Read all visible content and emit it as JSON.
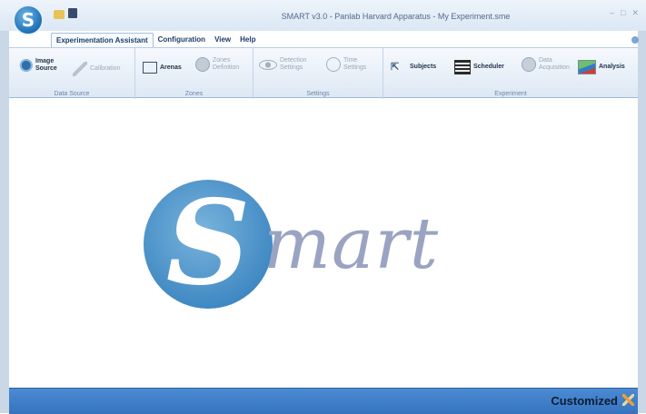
{
  "window": {
    "title": "SMART v3.0 - Panlab Harvard Apparatus - My Experiment.sme",
    "controls": [
      "minimize",
      "maximize",
      "close"
    ]
  },
  "quick_access": [
    "open-folder-icon",
    "save-icon"
  ],
  "tabs": [
    {
      "label": "Experimentation Assistant",
      "active": true
    },
    {
      "label": "Configuration",
      "active": false
    },
    {
      "label": "View",
      "active": false
    },
    {
      "label": "Help",
      "active": false
    }
  ],
  "ribbon": {
    "groups": [
      {
        "label": "Data Source",
        "buttons": [
          {
            "label_line1": "Image",
            "label_line2": "Source",
            "icon": "camera-icon",
            "enabled": true
          },
          {
            "label_line1": "Calibration",
            "label_line2": "",
            "icon": "ruler-icon",
            "enabled": false
          }
        ]
      },
      {
        "label": "Zones",
        "buttons": [
          {
            "label_line1": "Arenas",
            "label_line2": "",
            "icon": "arena-grid-icon",
            "enabled": true
          },
          {
            "label_line1": "Zones",
            "label_line2": "Definition",
            "icon": "zones-icon",
            "enabled": false
          }
        ]
      },
      {
        "label": "Settings",
        "buttons": [
          {
            "label_line1": "Detection",
            "label_line2": "Settings",
            "icon": "eye-icon",
            "enabled": false
          },
          {
            "label_line1": "Time",
            "label_line2": "Settings",
            "icon": "clock-icon",
            "enabled": false
          }
        ]
      },
      {
        "label": "Experiment",
        "buttons": [
          {
            "label_line1": "Subjects",
            "label_line2": "",
            "icon": "subjects-icon",
            "enabled": true
          },
          {
            "label_line1": "Scheduler",
            "label_line2": "",
            "icon": "scheduler-icon",
            "enabled": true
          },
          {
            "label_line1": "Data",
            "label_line2": "Acquisition",
            "icon": "data-acquisition-icon",
            "enabled": false
          },
          {
            "label_line1": "Analysis",
            "label_line2": "",
            "icon": "analysis-chart-icon",
            "enabled": true
          }
        ]
      }
    ]
  },
  "logo": {
    "letter": "S",
    "word": "mart"
  },
  "statusbar": {
    "text": "Customized",
    "icon": "tools-icon"
  }
}
